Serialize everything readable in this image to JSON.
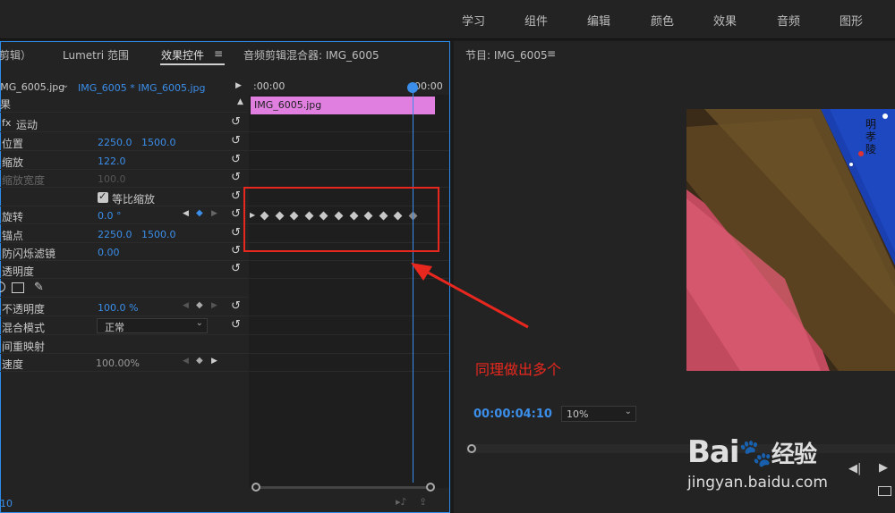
{
  "workspace_tabs": [
    "学习",
    "组件",
    "编辑",
    "颜色",
    "效果",
    "音频",
    "图形"
  ],
  "left_panel": {
    "tabs": [
      "剪辑）",
      "Lumetri 范围",
      "效果控件",
      "音频剪辑混合器: IMG_6005"
    ],
    "menu_icon": "≡",
    "source_clip": "IMG_6005.jpg",
    "sequence_clip": "IMG_6005 * IMG_6005.jpg",
    "time_start": ":00:00",
    "time_end": "00:00",
    "clip_label": "IMG_6005.jpg",
    "effects_header": "果",
    "motion_label": "运动",
    "properties": {
      "position": {
        "label": "位置",
        "x": "2250.0",
        "y": "1500.0"
      },
      "scale": {
        "label": "缩放",
        "value": "122.0"
      },
      "scale_width": {
        "label": "缩放宽度",
        "value": "100.0"
      },
      "uniform_scale": {
        "label": "等比缩放"
      },
      "rotation": {
        "label": "旋转",
        "value": "0.0 °"
      },
      "anchor": {
        "label": "锚点",
        "x": "2250.0",
        "y": "1500.0"
      },
      "flicker": {
        "label": "防闪烁滤镜",
        "value": "0.00"
      },
      "opacity_group": {
        "label": "透明度"
      },
      "opacity": {
        "label": "不透明度",
        "value": "100.0 %"
      },
      "blend_mode": {
        "label": "混合模式",
        "value": "正常"
      },
      "time_remap": {
        "label": "间重映射"
      },
      "speed": {
        "label": "速度",
        "value": "100.00%"
      }
    },
    "bottom_time": "10"
  },
  "right_panel": {
    "title": "节目: IMG_6005",
    "menu_icon": "≡",
    "timecode": "00:00:04:10",
    "zoom": "10%",
    "image_text": "明孝陵"
  },
  "annotation": "同理做出多个",
  "watermark": {
    "brand": "Bai",
    "brand_cn": "经验",
    "url": "jingyan.baidu.com"
  },
  "colors": {
    "accent": "#2d8ceb",
    "clip": "#e07fe0",
    "annotation": "#e8281e"
  },
  "keyframe_count": 11
}
